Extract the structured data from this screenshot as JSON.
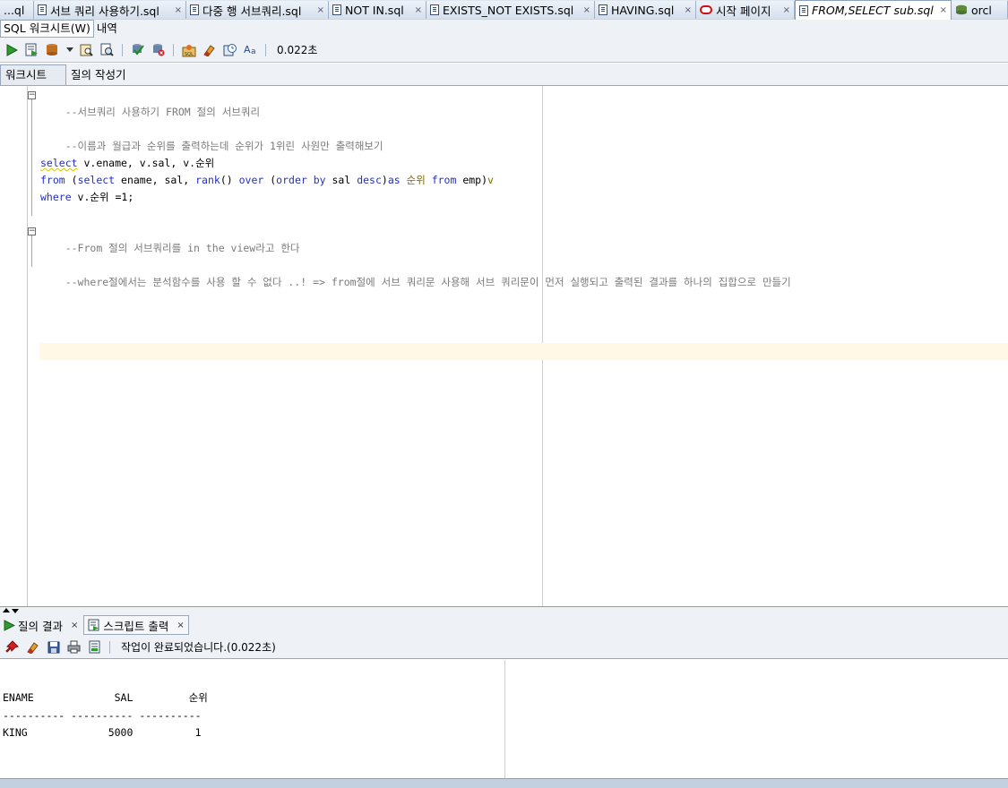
{
  "doc_tabs": [
    {
      "label": "...ql",
      "icon": "file-icon",
      "active": false,
      "closable": false
    },
    {
      "label": "서브 쿼리 사용하기.sql",
      "icon": "file-icon",
      "active": false,
      "closable": true
    },
    {
      "label": "다중 행 서브쿼리.sql",
      "icon": "file-icon",
      "active": false,
      "closable": true
    },
    {
      "label": "NOT IN.sql",
      "icon": "file-icon",
      "active": false,
      "closable": true
    },
    {
      "label": "EXISTS_NOT EXISTS.sql",
      "icon": "file-icon",
      "active": false,
      "closable": true
    },
    {
      "label": "HAVING.sql",
      "icon": "file-icon",
      "active": false,
      "closable": true
    },
    {
      "label": "시작 페이지",
      "icon": "oracle-icon",
      "active": false,
      "closable": true
    },
    {
      "label": "FROM,SELECT sub.sql",
      "icon": "file-icon",
      "active": true,
      "closable": true
    },
    {
      "label": "orcl",
      "icon": "db-icon",
      "active": false,
      "closable": false
    }
  ],
  "close_glyph": "×",
  "sub_tabs": [
    "SQL 워크시트(W)",
    "내역"
  ],
  "toolbar": {
    "buttons": [
      "run-statement-icon",
      "run-script-icon",
      "commit-icon",
      "dropdown-icon",
      "explain-plan-icon",
      "autotrace-icon",
      "commit-transaction-icon",
      "rollback-icon",
      "sql-tuning-icon",
      "clear-icon",
      "history-icon",
      "format-icon"
    ],
    "timing": "0.022초"
  },
  "worksheet_tabs": [
    "워크시트",
    "질의 작성기"
  ],
  "editor": {
    "lines": {
      "l1": "--서브쿼리 사용하기 FROM 절의 서브쿼리",
      "l3": "--이름과 월급과 순위를 출력하는데 순위가 1위린 사원만 출력해보기",
      "l5_kw1": "select",
      "l5_rest": " v.ename, v.sal, v.순위",
      "l6_kw1": "from",
      "l6_p1": " (",
      "l6_kw2": "select",
      "l6_p2": " ename, sal, ",
      "l6_fn": "rank",
      "l6_p3": "() ",
      "l6_kw3": "over",
      "l6_p4": " (",
      "l6_kw4": "order by",
      "l6_p5": " sal ",
      "l6_kw5": "desc",
      "l6_p6": ")",
      "l6_kw6": "as",
      "l6_kor": " 순위 ",
      "l6_kw7": "from",
      "l6_p7": " emp)",
      "l6_kor2": "v",
      "l7_kw1": "where",
      "l7_rest": " v.순위 =1;",
      "l9": "--From 절의 서브쿼리를 in the view라고 한다",
      "l11": "--where절에서는 분석함수를 사용 할 수 없다 ..! => from절에 서브 쿼리문 사용해 서브 쿼리문이 먼저 실행되고 출력된 결과를 하나의 집합으로 만들기"
    }
  },
  "output_tabs": [
    {
      "label": "질의 결과",
      "icon": "run-icon",
      "active": false
    },
    {
      "label": "스크립트 출력",
      "icon": "script-output-icon",
      "active": true
    }
  ],
  "output_toolbar": {
    "buttons": [
      "pin-icon",
      "clear-icon",
      "save-icon",
      "print-icon",
      "open-file-icon"
    ],
    "status": "작업이 완료되었습니다.(0.022초)"
  },
  "output": {
    "header": "ENAME             SAL         순위",
    "separator": "---------- ---------- ----------",
    "row": "KING             5000          1"
  }
}
